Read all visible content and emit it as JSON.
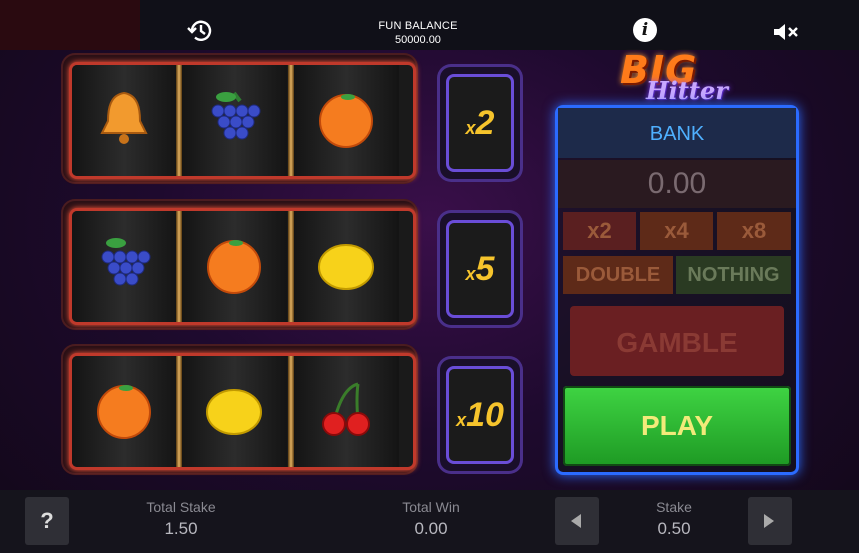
{
  "topbar": {
    "balance_label": "FUN BALANCE",
    "balance_value": "50000.00"
  },
  "icons": {
    "history": "history-icon",
    "info": "info-icon",
    "mute": "speaker-mute-icon",
    "help": "help-icon"
  },
  "reels": [
    {
      "symbols": [
        "bell",
        "grapes",
        "orange"
      ]
    },
    {
      "symbols": [
        "grapes",
        "orange",
        "lemon"
      ]
    },
    {
      "symbols": [
        "orange",
        "lemon",
        "cherries"
      ]
    }
  ],
  "multipliers": [
    {
      "prefix": "x",
      "value": "2"
    },
    {
      "prefix": "x",
      "value": "5"
    },
    {
      "prefix": "x",
      "value": "10"
    }
  ],
  "logo": {
    "line1": "BIG",
    "line2": "Hitter"
  },
  "bank": {
    "title": "BANK",
    "amount": "0.00",
    "multiplier_options": [
      "x2",
      "x4",
      "x8"
    ],
    "double_label": "DOUBLE",
    "nothing_label": "NOTHING",
    "gamble_label": "GAMBLE",
    "play_label": "PLAY"
  },
  "bottom": {
    "total_stake_label": "Total Stake",
    "total_stake_value": "1.50",
    "total_win_label": "Total Win",
    "total_win_value": "0.00",
    "stake_label": "Stake",
    "stake_value": "0.50",
    "help_label": "?"
  },
  "colors": {
    "reel_frame": "#c0392b",
    "multiplier_frame": "#6a4dd8",
    "bank_border": "#2b6bff",
    "play_green": "#2fbf33",
    "multiplier_text": "#f6c42c"
  }
}
